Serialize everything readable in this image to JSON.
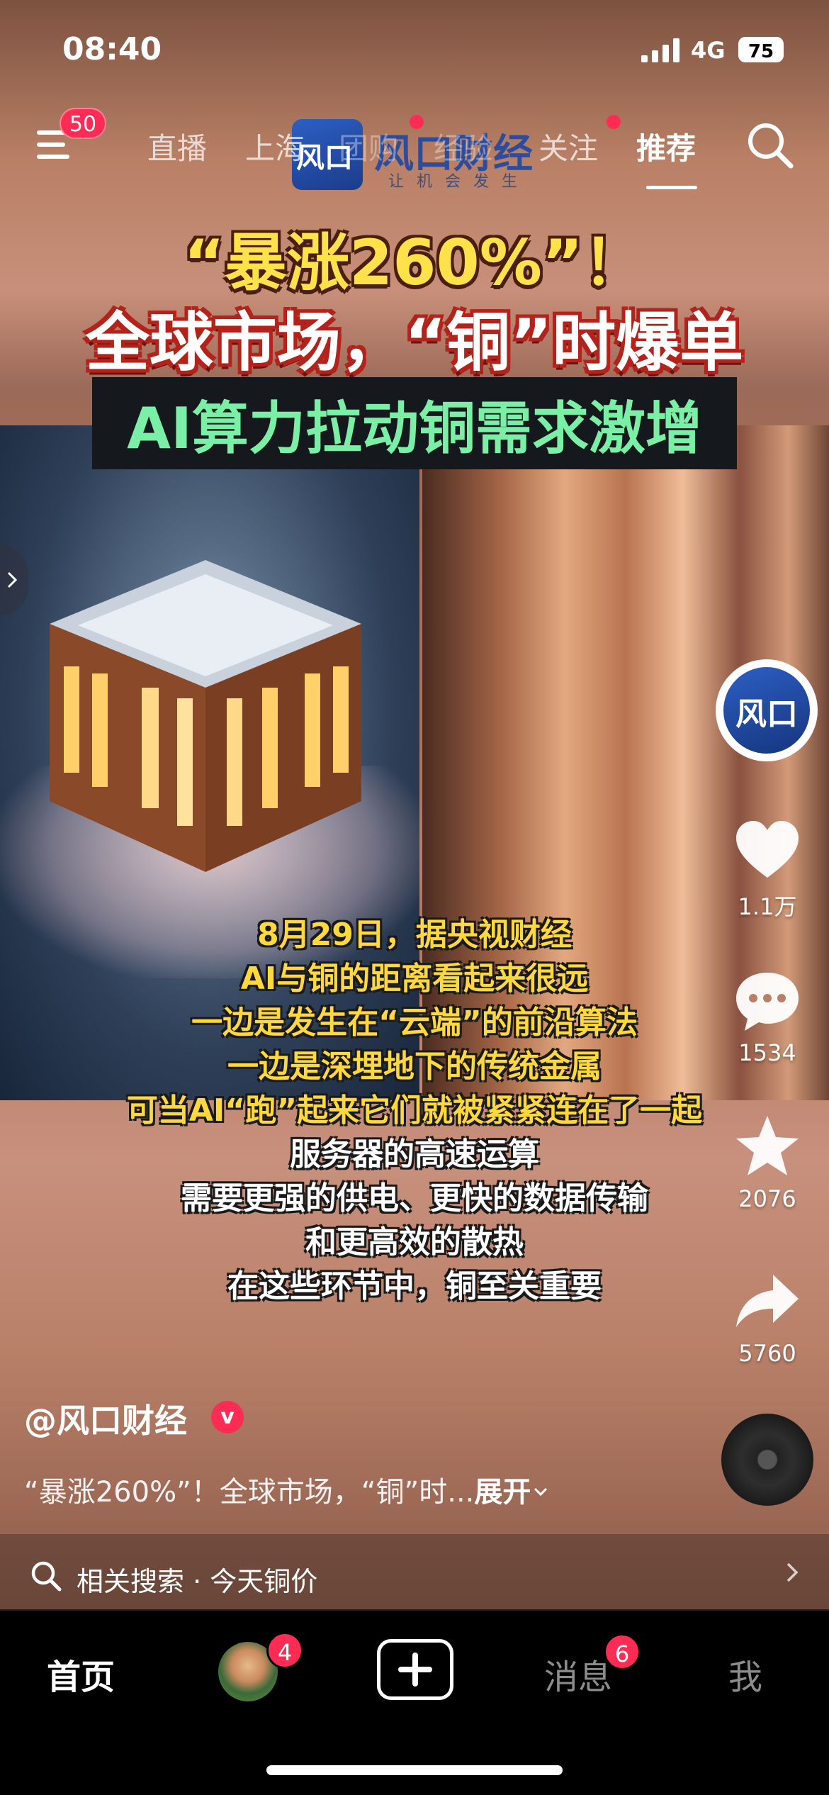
{
  "status_bar": {
    "time": "08:40",
    "network": "4G",
    "battery": "75"
  },
  "top_nav": {
    "menu_badge": "50",
    "tabs": [
      {
        "label": "直播"
      },
      {
        "label": "上海"
      },
      {
        "label": "团购"
      },
      {
        "label": "经验"
      },
      {
        "label": "关注"
      },
      {
        "label": "推荐"
      }
    ],
    "active_tab": "推荐"
  },
  "watermark": {
    "brand": "风口财经",
    "logo_text": "风口",
    "slogan": "让机会发生"
  },
  "video": {
    "headline_1": "“暴涨260%”！",
    "headline_2": "全球市场，“铜”时爆单",
    "headline_3": "AI算力拉动铜需求激增",
    "subtitles": [
      "8月29日，据央视财经",
      "AI与铜的距离看起来很远",
      "一边是发生在“云端”的前沿算法",
      "一边是深埋地下的传统金属",
      "可当AI“跑”起来它们就被紧紧连在了一起",
      "服务器的高速运算",
      "需要更强的供电、更快的数据传输",
      "和更高效的散热",
      "在这些环节中，铜至关重要"
    ]
  },
  "side_actions": {
    "avatar_text": "风口",
    "likes": "1.1万",
    "comments": "1534",
    "favorites": "2076",
    "shares": "5760"
  },
  "info": {
    "author": "@风口财经",
    "verified_mark": "v",
    "description": "“暴涨260%”！全球市场，“铜”时...",
    "expand": "展开"
  },
  "related": {
    "label": "相关搜索 · 今天铜价"
  },
  "tab_bar": {
    "home": "首页",
    "friends_badge": "4",
    "messages": "消息",
    "messages_badge": "6",
    "me": "我"
  },
  "colors": {
    "accent": "#fe2c55",
    "headline_yellow": "#ffe14a",
    "headline_green": "#7af0a6"
  }
}
